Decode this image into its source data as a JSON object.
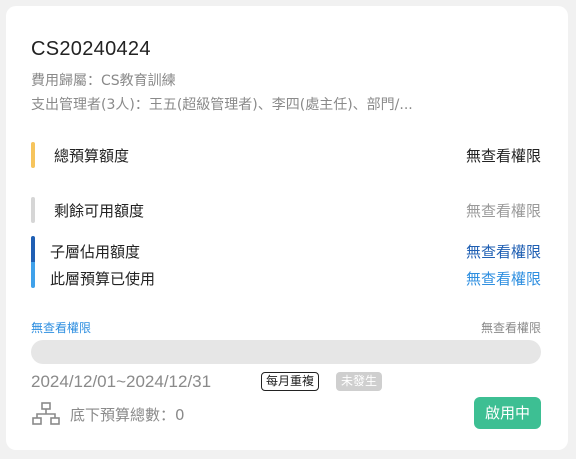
{
  "card": {
    "title": "CS20240424",
    "expense_owner": "費用歸屬：CS教育訓練",
    "managers": "支出管理者(3人)：王五(超級管理者)、李四(處主任)、部門/..."
  },
  "rows": {
    "total": {
      "label": "總預算額度",
      "value": "無查看權限"
    },
    "remaining": {
      "label": "剩餘可用額度",
      "value": "無查看權限"
    },
    "sub_used": {
      "label": "子層佔用額度",
      "value": "無查看權限"
    },
    "layer_used": {
      "label": "此層預算已使用",
      "value": "無查看權限"
    }
  },
  "progress": {
    "left_label": "無查看權限",
    "right_label": "無查看權限",
    "fraction": 0
  },
  "period": {
    "range": "2024/12/01~2024/12/31",
    "repeat_tag": "每月重複",
    "occur_tag": "未發生"
  },
  "footer": {
    "sub_budget_count": "底下預算總數：0",
    "status": "啟用中"
  },
  "colors": {
    "total_bar": "#f6c45c",
    "remaining_bar": "#d6d6d6",
    "sub_bar": "#1f5fb3",
    "layer_bar": "#3fa1ea",
    "status_bg": "#3dbf93"
  },
  "icons": {
    "hierarchy": "sitemap-icon"
  }
}
